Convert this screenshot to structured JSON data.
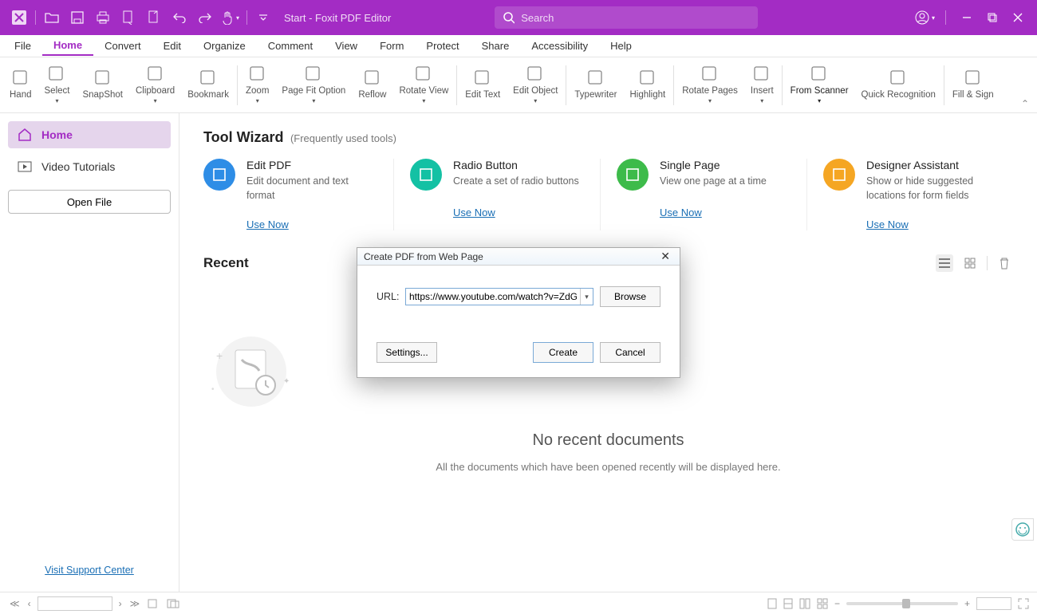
{
  "titlebar": {
    "title": "Start - Foxit PDF Editor",
    "search_placeholder": "Search"
  },
  "menu": [
    "File",
    "Home",
    "Convert",
    "Edit",
    "Organize",
    "Comment",
    "View",
    "Form",
    "Protect",
    "Share",
    "Accessibility",
    "Help"
  ],
  "menu_active": "Home",
  "ribbon": [
    {
      "label": "Hand"
    },
    {
      "label": "Select",
      "dd": true
    },
    {
      "label": "SnapShot"
    },
    {
      "label": "Clipboard",
      "dd": true
    },
    {
      "label": "Bookmark"
    },
    {
      "sep": true
    },
    {
      "label": "Zoom",
      "dd": true
    },
    {
      "label": "Page Fit Option",
      "dd": true
    },
    {
      "label": "Reflow"
    },
    {
      "label": "Rotate View",
      "dd": true
    },
    {
      "sep": true
    },
    {
      "label": "Edit Text"
    },
    {
      "label": "Edit Object",
      "dd": true
    },
    {
      "sep": true
    },
    {
      "label": "Typewriter"
    },
    {
      "label": "Highlight"
    },
    {
      "sep": true
    },
    {
      "label": "Rotate Pages",
      "dd": true
    },
    {
      "label": "Insert",
      "dd": true
    },
    {
      "sep": true
    },
    {
      "label": "From Scanner",
      "dd": true,
      "sel": true
    },
    {
      "label": "Quick Recognition"
    },
    {
      "sep": true
    },
    {
      "label": "Fill & Sign"
    }
  ],
  "sidebar": {
    "home": "Home",
    "video": "Video Tutorials",
    "open_file": "Open File",
    "support": "Visit Support Center"
  },
  "tool_wizard": {
    "title": "Tool Wizard",
    "subtitle": "(Frequently used tools)",
    "use_now": "Use Now",
    "cards": [
      {
        "title": "Edit PDF",
        "desc": "Edit document and text format",
        "color": "#2e8de6"
      },
      {
        "title": "Radio Button",
        "desc": "Create a set of radio buttons",
        "color": "#14c1a4"
      },
      {
        "title": "Single Page",
        "desc": "View one page at a time",
        "color": "#3dbb4a"
      },
      {
        "title": "Designer Assistant",
        "desc": "Show or hide suggested locations for form fields",
        "color": "#f5a623"
      }
    ]
  },
  "recent": {
    "title": "Recent",
    "empty_title": "No recent documents",
    "empty_sub": "All the documents which have been opened recently will be displayed here."
  },
  "dialog": {
    "title": "Create PDF from Web Page",
    "url_label": "URL:",
    "url_value": "https://www.youtube.com/watch?v=ZdGWTtyr",
    "browse": "Browse",
    "settings": "Settings...",
    "create": "Create",
    "cancel": "Cancel"
  }
}
